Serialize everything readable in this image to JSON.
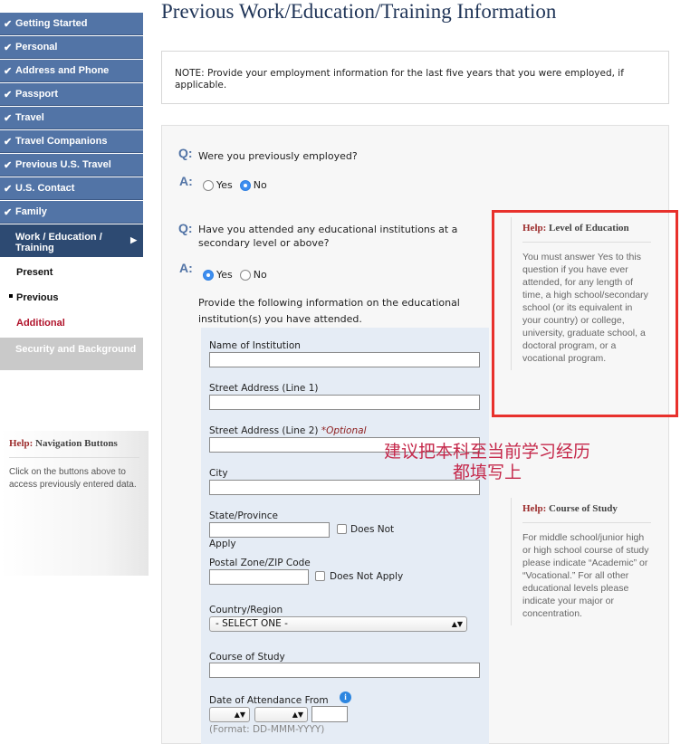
{
  "nav": {
    "completed": [
      "Getting Started",
      "Personal",
      "Address and Phone",
      "Passport",
      "Travel",
      "Travel Companions",
      "Previous U.S. Travel",
      "U.S. Contact",
      "Family"
    ],
    "check_glyph": "✔",
    "current": "Work / Education / Training",
    "current_arrow": "▶",
    "subitems": {
      "present": "Present",
      "previous": "Previous",
      "additional": "Additional"
    },
    "disabled": "Security and Background"
  },
  "help_nav": {
    "prefix": "Help:",
    "title": "Navigation Buttons",
    "body": "Click on the buttons above to access previously entered data."
  },
  "page": {
    "title": "Previous Work/Education/Training Information",
    "note": "NOTE: Provide your employment information for the last five years that you were employed, if applicable."
  },
  "questions": {
    "q_marker": "Q:",
    "a_marker": "A:",
    "employed": {
      "text": "Were you previously employed?",
      "yes": "Yes",
      "no": "No",
      "selected": "No"
    },
    "education": {
      "text": "Have you attended any educational institutions at a secondary level or above?",
      "yes": "Yes",
      "no": "No",
      "selected": "Yes"
    },
    "instructions": "Provide the following information on the educational institution(s) you have attended."
  },
  "fields": {
    "institution": "Name of Institution",
    "street1": "Street Address (Line 1)",
    "street2": "Street Address (Line 2)",
    "street2_optional": "*Optional",
    "city": "City",
    "state": "State/Province",
    "state_na_a": "Does Not",
    "state_na_b": "Apply",
    "postal": "Postal Zone/ZIP Code",
    "postal_na": "Does Not Apply",
    "country": "Country/Region",
    "country_value": "- SELECT ONE -",
    "course": "Course of Study",
    "date_from": "Date of Attendance From",
    "format": "(Format: DD-MMM-YYYY)",
    "info_glyph": "i",
    "updown_glyph": "▲▼"
  },
  "help_education": {
    "prefix": "Help:",
    "title": "Level of Education",
    "body": "You must answer Yes to this question if you have ever attended, for any length of time, a high school/secondary school (or its equivalent in your country) or college, university, graduate school, a doctoral program, or a vocational program."
  },
  "help_course": {
    "prefix": "Help:",
    "title": "Course of Study",
    "body": "For middle school/junior high or high school course of study please indicate “Academic” or “Vocational.” For all other educational levels please indicate your major or concentration."
  },
  "annotation": {
    "line1": "建议把本科至当前学习经历",
    "line2": "都填写上"
  },
  "colors": {
    "nav_blue": "#5274a6",
    "nav_current": "#2d4a72",
    "highlight_red": "#e8312c",
    "annotation_pink": "#c5294b"
  }
}
